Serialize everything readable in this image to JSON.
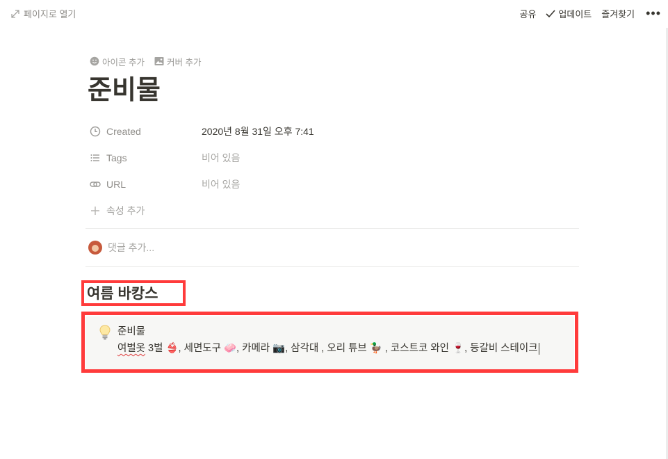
{
  "topbar": {
    "open_as_page": "페이지로 열기",
    "share": "공유",
    "updates": "업데이트",
    "favorite": "즐겨찾기",
    "more": "•••"
  },
  "page": {
    "add_icon": "아이콘 추가",
    "add_cover": "커버 추가",
    "title": "준비물"
  },
  "properties": [
    {
      "icon": "clock-icon",
      "name": "Created",
      "value": "2020년 8월 31일 오후 7:41",
      "empty": false
    },
    {
      "icon": "list-icon",
      "name": "Tags",
      "value": "비어 있음",
      "empty": true
    },
    {
      "icon": "link-icon",
      "name": "URL",
      "value": "비어 있음",
      "empty": true
    }
  ],
  "add_property": "속성 추가",
  "comment_placeholder": "댓글 추가...",
  "section_heading": "여름 바캉스",
  "callout": {
    "icon": "lightbulb-icon",
    "title": "준비물",
    "text_misspelled": "여벌옷",
    "text_rest": " 3벌 👙, 세면도구 🧼, 카메라 📷, 삼각대 , 오리 튜브 🦆 , 코스트코 와인 🍷, 등갈비 스테이크"
  },
  "colors": {
    "highlight_border": "#ff3b3b",
    "callout_bg": "#f7f7f5",
    "text": "#37352f",
    "muted": "#9b9a97"
  }
}
